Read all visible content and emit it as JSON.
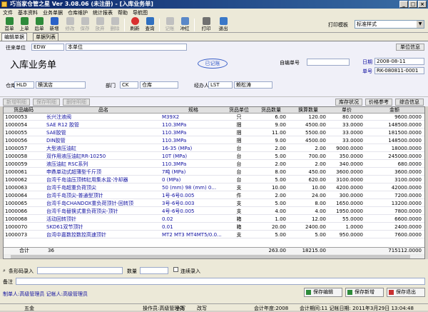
{
  "window": {
    "title": "巧当家仓管之星 Ver 3.08.06 (未注册) - [入库业务单]"
  },
  "menu": [
    "文件",
    "基本资料",
    "业务单据",
    "仓库维护",
    "统计报表",
    "帮助",
    "导航图"
  ],
  "window_menu": [
    "系统",
    "最小化",
    "还原",
    "关闭"
  ],
  "toolbar": {
    "buttons": [
      {
        "label": "首单",
        "icon": "first-icon",
        "enabled": true
      },
      {
        "label": "上单",
        "icon": "prev-icon",
        "enabled": true
      },
      {
        "label": "后单",
        "icon": "next-icon",
        "enabled": true
      },
      {
        "label": "新增",
        "icon": "new-icon",
        "enabled": true
      },
      {
        "label": "修改",
        "icon": "edit-icon",
        "enabled": false
      },
      {
        "label": "保存",
        "icon": "save-icon",
        "enabled": false
      },
      {
        "label": "放弃",
        "icon": "cancel-icon",
        "enabled": false
      },
      {
        "label": "删除",
        "icon": "delete-icon",
        "enabled": false
      },
      {
        "label": "刷新",
        "icon": "refresh-icon",
        "enabled": true
      },
      {
        "label": "查询",
        "icon": "query-icon",
        "enabled": true
      },
      {
        "label": "记账",
        "icon": "post-icon",
        "enabled": false
      },
      {
        "label": "冲红",
        "icon": "reverse-icon",
        "enabled": true
      },
      {
        "label": "打印",
        "icon": "print-icon",
        "enabled": true
      },
      {
        "label": "退出",
        "icon": "exit-icon",
        "enabled": true
      }
    ],
    "print_template_label": "打印模板",
    "print_template_value": "标准样式"
  },
  "tabs": [
    "编辑单据",
    "单据列表"
  ],
  "form": {
    "supplier_label": "往来单位",
    "supplier_code": "EDW",
    "supplier_name": "本单位",
    "unit_info_button": "单位信息",
    "title": "入库业务单",
    "status_stamp": "已记账",
    "own_no_label": "自编单号",
    "own_no_value": "",
    "date_label": "日期",
    "date_value": "2008-08-11",
    "doc_no_label": "单号",
    "doc_no_value": "RK-080811-0001",
    "warehouse_label": "仓库",
    "warehouse_code": "HLD",
    "warehouse_name": "横滨店",
    "dept_label": "部门",
    "dept_code": "CK",
    "dept_name": "仓库",
    "handler_label": "经办人",
    "handler_code": "LST",
    "handler_name": "赖松涛"
  },
  "actions": {
    "left": [
      "新增明细",
      "保存明细",
      "删除明细"
    ],
    "right": [
      "库存状况",
      "价格参考",
      "综合信息"
    ]
  },
  "grid": {
    "columns": [
      "货品编码",
      "品名",
      "规格",
      "货品单位",
      "货品数量",
      "换算数量",
      "单价",
      "金额"
    ],
    "rows": [
      [
        "1000053",
        "长兴注液阀",
        "M39X2",
        "只",
        "6.00",
        "120.00",
        "80.0000",
        "9600.0000"
      ],
      [
        "1000054",
        "SAE R12 胶管",
        "110.3MPa",
        "捆",
        "9.00",
        "4500.00",
        "33.0000",
        "148500.0000"
      ],
      [
        "1000055",
        "SAE胶管",
        "110.3MPa",
        "捆",
        "11.00",
        "5500.00",
        "33.0000",
        "181500.0000"
      ],
      [
        "1000056",
        "DIN胶管",
        "110.3MPa",
        "捆",
        "9.00",
        "4500.00",
        "33.0000",
        "148500.0000"
      ],
      [
        "1000057",
        "大型液压油缸",
        "16-35 (MPa)",
        "台",
        "2.00",
        "2.00",
        "9000.0000",
        "18000.0000"
      ],
      [
        "1000058",
        "双作用液压油缸RR-10250",
        "10T (MPa)",
        "台",
        "5.00",
        "700.00",
        "350.0000",
        "245000.0000"
      ],
      [
        "1000059",
        "液压油缸 RSC系列",
        "110.3MPa",
        "台",
        "2.00",
        "2.00",
        "340.0000",
        "680.0000"
      ],
      [
        "1000061",
        "申鼎单动式超薄型千斤顶",
        "7吨 (MPa)",
        "台",
        "8.00",
        "450.00",
        "3600.0000",
        "3600.0000"
      ],
      [
        "1000062",
        "台湾千岛油压顶转缸用集水盆-冷却器",
        "0 (MPa)",
        "台",
        "5.00",
        "620.00",
        "3100.0000",
        "3100.0000"
      ],
      [
        "1000063",
        "台湾千岛超重负荷顶尖",
        "50 (mm) 98 (mm) 0...",
        "支",
        "10.00",
        "10.00",
        "4200.0000",
        "42000.0000"
      ],
      [
        "1000064",
        "台湾千岛顶尖-普通型顶针",
        "1号-6号0.005",
        "件",
        "2.00",
        "24.00",
        "300.0000",
        "7200.0000"
      ],
      [
        "1000065",
        "台湾千岛CHANDOX重负荷顶针-回转顶",
        "3号-6号0.003",
        "支",
        "5.00",
        "8.00",
        "1650.0000",
        "13200.0000"
      ],
      [
        "1000066",
        "台湾千岛替换式重负荷顶尖-顶针",
        "4号-6号0.005",
        "支",
        "4.00",
        "4.00",
        "1950.0000",
        "7800.0000"
      ],
      [
        "1000068",
        "活动回转顶针",
        "0.02",
        "箱",
        "1.00",
        "12.00",
        "55.0000",
        "6600.0000"
      ],
      [
        "1000070",
        "SKD61双节顶针",
        "0.01",
        "箱",
        "20.00",
        "2400.00",
        "1.0000",
        "2400.0000"
      ],
      [
        "1000073",
        "台湾中嘉数控数控高速顶针",
        "MT2 MT3 MT4MT5/0.0...",
        "支",
        "5.00",
        "5.00",
        "950.0000",
        "7600.0000"
      ]
    ],
    "total_label": "合计",
    "total_count": "36",
    "total_qty": "263.00",
    "total_conv": "18215.00",
    "total_amount": "715112.0000"
  },
  "bottom": {
    "barcode_label": "条形码录入",
    "qty_label": "数量",
    "continuous_label": "连续录入",
    "remark_label": "备注",
    "creator_text": "制单人:高级管理员   记帐人:高级管理员",
    "save_edit": "保存编辑",
    "save_add": "保存新增",
    "save_exit": "保存退出"
  },
  "statusbar": {
    "location": "五金",
    "operator": "操作员:高级管理员",
    "caps": "小写",
    "ins": "改写",
    "period": "会计年度:2008",
    "time": "会计期间:11 记帐日期: 2011年3月29日 13:04:48"
  }
}
